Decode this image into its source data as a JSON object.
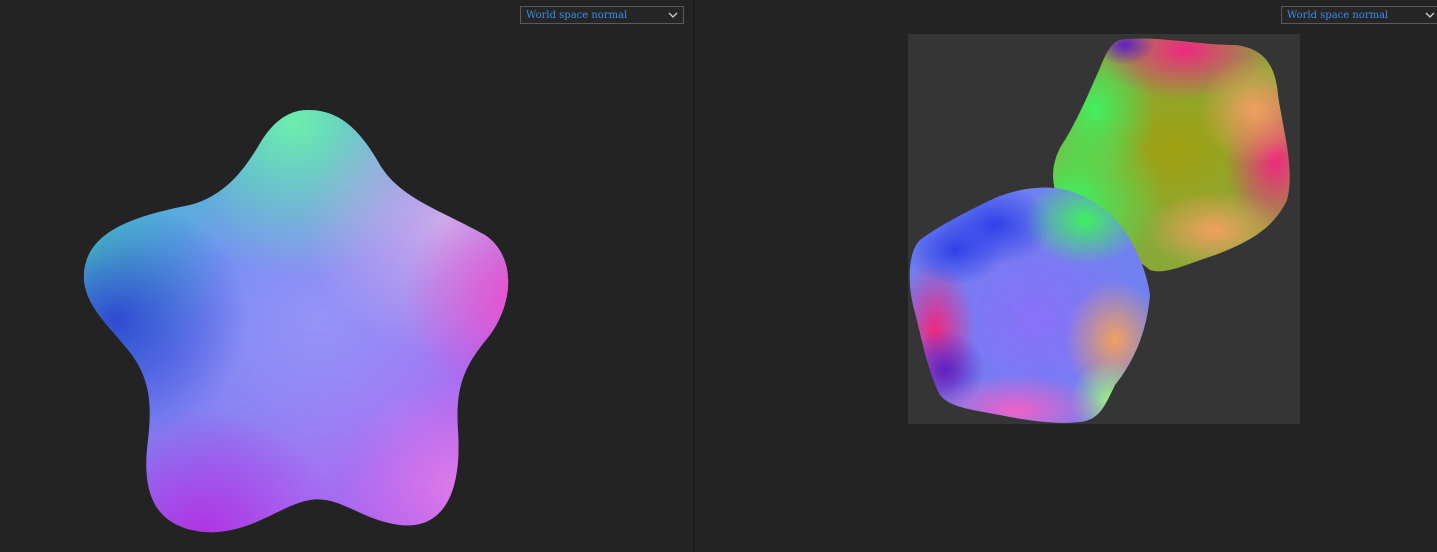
{
  "left_viewport": {
    "display_mode": "World space normal",
    "preview": "star-shaped mesh rendered with world space normals"
  },
  "right_viewport": {
    "display_mode": "World space normal",
    "preview": "UV texture layout with world space normal colors"
  },
  "icons": {
    "dropdown": "chevron-down-icon"
  },
  "colors": {
    "background": "#232323",
    "uv_panel": "#353535",
    "select_text": "#3d8ee8",
    "select_border": "#5a5a5a"
  }
}
